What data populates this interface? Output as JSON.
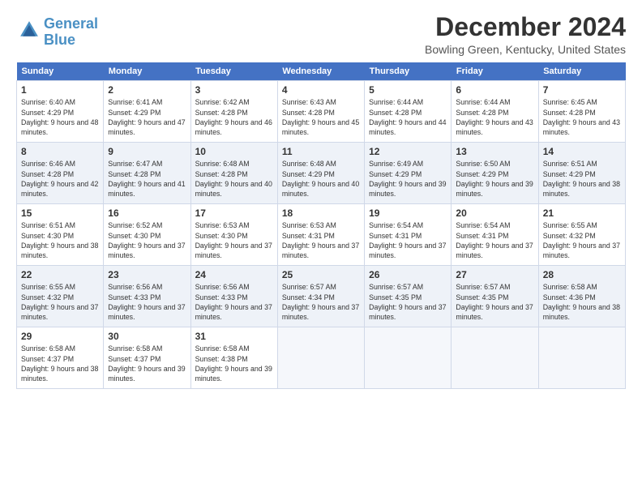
{
  "logo": {
    "line1": "General",
    "line2": "Blue"
  },
  "title": "December 2024",
  "subtitle": "Bowling Green, Kentucky, United States",
  "weekdays": [
    "Sunday",
    "Monday",
    "Tuesday",
    "Wednesday",
    "Thursday",
    "Friday",
    "Saturday"
  ],
  "days": [
    {
      "date": "",
      "sunrise": "",
      "sunset": "",
      "daylight": ""
    },
    {
      "date": "",
      "sunrise": "",
      "sunset": "",
      "daylight": ""
    },
    {
      "date": "",
      "sunrise": "",
      "sunset": "",
      "daylight": ""
    },
    {
      "date": "",
      "sunrise": "",
      "sunset": "",
      "daylight": ""
    },
    {
      "date": "",
      "sunrise": "",
      "sunset": "",
      "daylight": ""
    },
    {
      "date": "",
      "sunrise": "",
      "sunset": "",
      "daylight": ""
    },
    {
      "date": "",
      "sunrise": "",
      "sunset": "",
      "daylight": ""
    },
    {
      "date": "1",
      "sunrise": "Sunrise: 6:40 AM",
      "sunset": "Sunset: 4:29 PM",
      "daylight": "Daylight: 9 hours and 48 minutes."
    },
    {
      "date": "2",
      "sunrise": "Sunrise: 6:41 AM",
      "sunset": "Sunset: 4:29 PM",
      "daylight": "Daylight: 9 hours and 47 minutes."
    },
    {
      "date": "3",
      "sunrise": "Sunrise: 6:42 AM",
      "sunset": "Sunset: 4:28 PM",
      "daylight": "Daylight: 9 hours and 46 minutes."
    },
    {
      "date": "4",
      "sunrise": "Sunrise: 6:43 AM",
      "sunset": "Sunset: 4:28 PM",
      "daylight": "Daylight: 9 hours and 45 minutes."
    },
    {
      "date": "5",
      "sunrise": "Sunrise: 6:44 AM",
      "sunset": "Sunset: 4:28 PM",
      "daylight": "Daylight: 9 hours and 44 minutes."
    },
    {
      "date": "6",
      "sunrise": "Sunrise: 6:44 AM",
      "sunset": "Sunset: 4:28 PM",
      "daylight": "Daylight: 9 hours and 43 minutes."
    },
    {
      "date": "7",
      "sunrise": "Sunrise: 6:45 AM",
      "sunset": "Sunset: 4:28 PM",
      "daylight": "Daylight: 9 hours and 43 minutes."
    },
    {
      "date": "8",
      "sunrise": "Sunrise: 6:46 AM",
      "sunset": "Sunset: 4:28 PM",
      "daylight": "Daylight: 9 hours and 42 minutes."
    },
    {
      "date": "9",
      "sunrise": "Sunrise: 6:47 AM",
      "sunset": "Sunset: 4:28 PM",
      "daylight": "Daylight: 9 hours and 41 minutes."
    },
    {
      "date": "10",
      "sunrise": "Sunrise: 6:48 AM",
      "sunset": "Sunset: 4:28 PM",
      "daylight": "Daylight: 9 hours and 40 minutes."
    },
    {
      "date": "11",
      "sunrise": "Sunrise: 6:48 AM",
      "sunset": "Sunset: 4:29 PM",
      "daylight": "Daylight: 9 hours and 40 minutes."
    },
    {
      "date": "12",
      "sunrise": "Sunrise: 6:49 AM",
      "sunset": "Sunset: 4:29 PM",
      "daylight": "Daylight: 9 hours and 39 minutes."
    },
    {
      "date": "13",
      "sunrise": "Sunrise: 6:50 AM",
      "sunset": "Sunset: 4:29 PM",
      "daylight": "Daylight: 9 hours and 39 minutes."
    },
    {
      "date": "14",
      "sunrise": "Sunrise: 6:51 AM",
      "sunset": "Sunset: 4:29 PM",
      "daylight": "Daylight: 9 hours and 38 minutes."
    },
    {
      "date": "15",
      "sunrise": "Sunrise: 6:51 AM",
      "sunset": "Sunset: 4:30 PM",
      "daylight": "Daylight: 9 hours and 38 minutes."
    },
    {
      "date": "16",
      "sunrise": "Sunrise: 6:52 AM",
      "sunset": "Sunset: 4:30 PM",
      "daylight": "Daylight: 9 hours and 37 minutes."
    },
    {
      "date": "17",
      "sunrise": "Sunrise: 6:53 AM",
      "sunset": "Sunset: 4:30 PM",
      "daylight": "Daylight: 9 hours and 37 minutes."
    },
    {
      "date": "18",
      "sunrise": "Sunrise: 6:53 AM",
      "sunset": "Sunset: 4:31 PM",
      "daylight": "Daylight: 9 hours and 37 minutes."
    },
    {
      "date": "19",
      "sunrise": "Sunrise: 6:54 AM",
      "sunset": "Sunset: 4:31 PM",
      "daylight": "Daylight: 9 hours and 37 minutes."
    },
    {
      "date": "20",
      "sunrise": "Sunrise: 6:54 AM",
      "sunset": "Sunset: 4:31 PM",
      "daylight": "Daylight: 9 hours and 37 minutes."
    },
    {
      "date": "21",
      "sunrise": "Sunrise: 6:55 AM",
      "sunset": "Sunset: 4:32 PM",
      "daylight": "Daylight: 9 hours and 37 minutes."
    },
    {
      "date": "22",
      "sunrise": "Sunrise: 6:55 AM",
      "sunset": "Sunset: 4:32 PM",
      "daylight": "Daylight: 9 hours and 37 minutes."
    },
    {
      "date": "23",
      "sunrise": "Sunrise: 6:56 AM",
      "sunset": "Sunset: 4:33 PM",
      "daylight": "Daylight: 9 hours and 37 minutes."
    },
    {
      "date": "24",
      "sunrise": "Sunrise: 6:56 AM",
      "sunset": "Sunset: 4:33 PM",
      "daylight": "Daylight: 9 hours and 37 minutes."
    },
    {
      "date": "25",
      "sunrise": "Sunrise: 6:57 AM",
      "sunset": "Sunset: 4:34 PM",
      "daylight": "Daylight: 9 hours and 37 minutes."
    },
    {
      "date": "26",
      "sunrise": "Sunrise: 6:57 AM",
      "sunset": "Sunset: 4:35 PM",
      "daylight": "Daylight: 9 hours and 37 minutes."
    },
    {
      "date": "27",
      "sunrise": "Sunrise: 6:57 AM",
      "sunset": "Sunset: 4:35 PM",
      "daylight": "Daylight: 9 hours and 37 minutes."
    },
    {
      "date": "28",
      "sunrise": "Sunrise: 6:58 AM",
      "sunset": "Sunset: 4:36 PM",
      "daylight": "Daylight: 9 hours and 38 minutes."
    },
    {
      "date": "29",
      "sunrise": "Sunrise: 6:58 AM",
      "sunset": "Sunset: 4:37 PM",
      "daylight": "Daylight: 9 hours and 38 minutes."
    },
    {
      "date": "30",
      "sunrise": "Sunrise: 6:58 AM",
      "sunset": "Sunset: 4:37 PM",
      "daylight": "Daylight: 9 hours and 39 minutes."
    },
    {
      "date": "31",
      "sunrise": "Sunrise: 6:58 AM",
      "sunset": "Sunset: 4:38 PM",
      "daylight": "Daylight: 9 hours and 39 minutes."
    },
    {
      "date": "",
      "sunrise": "",
      "sunset": "",
      "daylight": ""
    },
    {
      "date": "",
      "sunrise": "",
      "sunset": "",
      "daylight": ""
    },
    {
      "date": "",
      "sunrise": "",
      "sunset": "",
      "daylight": ""
    },
    {
      "date": "",
      "sunrise": "",
      "sunset": "",
      "daylight": ""
    }
  ]
}
